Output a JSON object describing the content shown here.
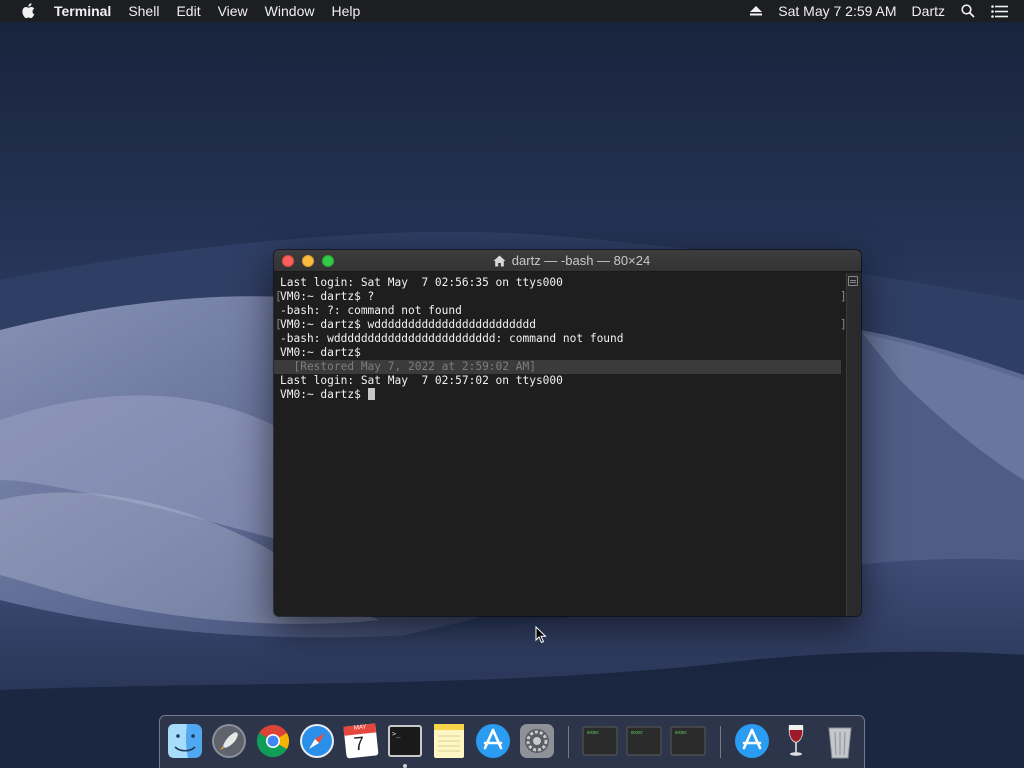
{
  "menubar": {
    "app_name": "Terminal",
    "items": [
      "Shell",
      "Edit",
      "View",
      "Window",
      "Help"
    ],
    "clock": "Sat May 7  2:59 AM",
    "user": "Dartz",
    "icons": [
      "apple-icon",
      "eject-icon",
      "spotlight-search-icon",
      "notification-center-icon"
    ]
  },
  "window": {
    "title": "dartz — -bash — 80×24",
    "lines": [
      "Last login: Sat May  7 02:56:35 on ttys000",
      "VM0:~ dartz$ ?",
      "-bash: ?: command not found",
      "VM0:~ dartz$ wdddddddddddddddddddddddd",
      "-bash: wdddddddddddddddddddddddd: command not found",
      "VM0:~ dartz$ ",
      "  [Restored May 7, 2022 at 2:59:02 AM]",
      "Last login: Sat May  7 02:57:02 on ttys000",
      "VM0:~ dartz$ "
    ]
  },
  "dock": {
    "apps": [
      {
        "name": "Finder",
        "icon": "finder-icon"
      },
      {
        "name": "Launchpad",
        "icon": "launchpad-icon"
      },
      {
        "name": "Google Chrome",
        "icon": "chrome-icon"
      },
      {
        "name": "Safari",
        "icon": "safari-icon"
      },
      {
        "name": "Calendar",
        "icon": "calendar-icon",
        "month": "MAY",
        "day": "7"
      },
      {
        "name": "Terminal",
        "icon": "terminal-icon",
        "running": true
      },
      {
        "name": "Notes",
        "icon": "notes-icon"
      },
      {
        "name": "App Store",
        "icon": "app-store-icon"
      },
      {
        "name": "System Preferences",
        "icon": "system-preferences-icon"
      }
    ],
    "documents": [
      {
        "label": "exec",
        "icon": "exec-file-icon"
      },
      {
        "label": "exec",
        "icon": "exec-file-icon"
      },
      {
        "label": "exec",
        "icon": "exec-file-icon"
      }
    ],
    "extras": [
      {
        "name": "App Store",
        "icon": "app-store-icon"
      },
      {
        "name": "Wine",
        "icon": "wine-icon"
      },
      {
        "name": "Trash",
        "icon": "trash-icon"
      }
    ]
  },
  "colors": {
    "menubar": "#1e1e20",
    "terminal_bg": "#1e1e1e",
    "terminal_text": "#f2f2f2",
    "close": "#fc605c",
    "minimize": "#fdbc40",
    "zoom": "#34c84a"
  }
}
